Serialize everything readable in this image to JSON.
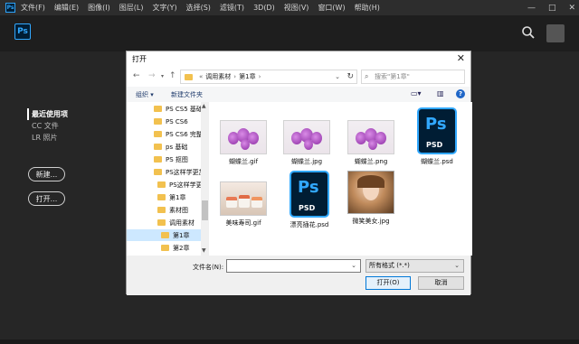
{
  "menubar": {
    "app_icon": "Ps",
    "items": [
      "文件(F)",
      "编辑(E)",
      "图像(I)",
      "图层(L)",
      "文字(Y)",
      "选择(S)",
      "滤镜(T)",
      "3D(D)",
      "视图(V)",
      "窗口(W)",
      "帮助(H)"
    ],
    "window_controls": [
      "—",
      "□",
      "✕"
    ]
  },
  "home": {
    "logo": "Ps",
    "nav": [
      "最近使用项",
      "CC 文件",
      "LR 照片"
    ],
    "new_button": "新建...",
    "open_button": "打开..."
  },
  "dialog": {
    "title": "打开",
    "close": "✕",
    "address": {
      "prefix": "«",
      "crumbs": [
        "调用素材",
        "第1章"
      ],
      "search_placeholder": "搜索\"第1章\""
    },
    "toolbar": {
      "organize": "组织 ▾",
      "new_folder": "新建文件夹",
      "help": "?"
    },
    "tree": [
      {
        "label": "PS CS5 基础"
      },
      {
        "label": "PS CS6"
      },
      {
        "label": "PS CS6  完整"
      },
      {
        "label": "ps 基础"
      },
      {
        "label": "PS 抠图"
      },
      {
        "label": "PS这样学更加"
      },
      {
        "label": "PS这样学更"
      },
      {
        "label": "第1章"
      },
      {
        "label": "素材图"
      },
      {
        "label": "调用素材"
      },
      {
        "label": "第1章"
      },
      {
        "label": "第2章"
      }
    ],
    "files": [
      {
        "name": "蝴蝶兰.gif",
        "kind": "orchid"
      },
      {
        "name": "蝴蝶兰.jpg",
        "kind": "orchid"
      },
      {
        "name": "蝴蝶兰.png",
        "kind": "orchid"
      },
      {
        "name": "蝴蝶兰.psd",
        "kind": "psd"
      },
      {
        "name": "美味寿司.gif",
        "kind": "sushi"
      },
      {
        "name": "漂亮插花.psd",
        "kind": "psd"
      },
      {
        "name": "微笑美女.jpg",
        "kind": "portrait"
      }
    ],
    "psd_badge": {
      "ps": "Ps",
      "ext": "PSD"
    },
    "filename_label": "文件名(N):",
    "filename_value": "",
    "filetype": "所有格式 (*.*)",
    "open_button": "打开(O)",
    "cancel_button": "取消"
  }
}
